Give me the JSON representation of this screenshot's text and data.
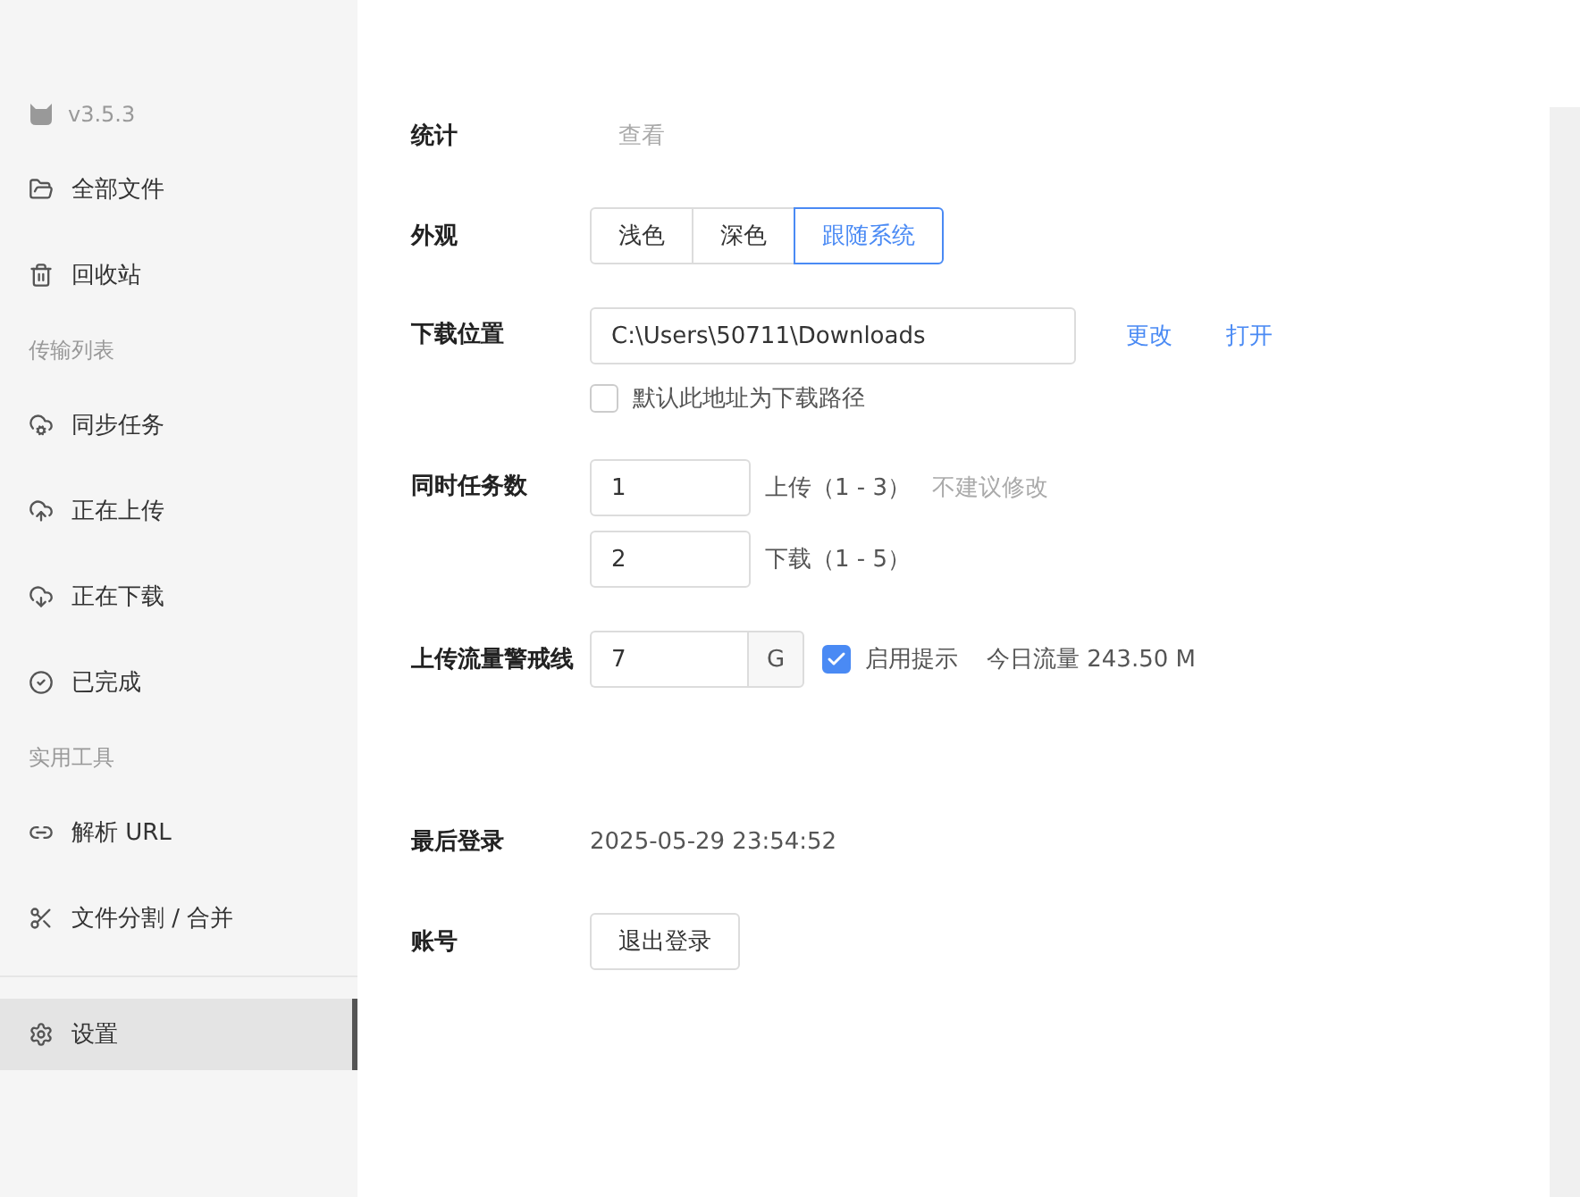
{
  "app": {
    "version": "v3.5.3"
  },
  "sidebar": {
    "items": [
      {
        "kind": "item",
        "label": "全部文件",
        "selected": false
      },
      {
        "kind": "item",
        "label": "回收站",
        "selected": false
      },
      {
        "kind": "section",
        "label": "传输列表"
      },
      {
        "kind": "item",
        "label": "同步任务",
        "selected": false
      },
      {
        "kind": "item",
        "label": "正在上传",
        "selected": false
      },
      {
        "kind": "item",
        "label": "正在下载",
        "selected": false
      },
      {
        "kind": "item",
        "label": "已完成",
        "selected": false
      },
      {
        "kind": "section",
        "label": "实用工具"
      },
      {
        "kind": "item",
        "label": "解析 URL",
        "selected": false
      },
      {
        "kind": "item",
        "label": "文件分割 / 合并",
        "selected": false
      },
      {
        "kind": "divider"
      },
      {
        "kind": "item",
        "label": "设置",
        "selected": true
      }
    ]
  },
  "settings": {
    "stats": {
      "label": "统计",
      "link": "查看"
    },
    "appearance": {
      "label": "外观",
      "options": [
        {
          "label": "浅色",
          "selected": false
        },
        {
          "label": "深色",
          "selected": false
        },
        {
          "label": "跟随系统",
          "selected": true
        }
      ]
    },
    "download_location": {
      "label": "下载位置",
      "value": "C:\\Users\\50711\\Downloads",
      "change": "更改",
      "open": "打开",
      "default_checkbox": {
        "label": "默认此地址为下载路径",
        "checked": false
      }
    },
    "concurrent_tasks": {
      "label": "同时任务数",
      "upload": {
        "value": "1",
        "label": "上传（1 - 3）",
        "hint": "不建议修改"
      },
      "download": {
        "value": "2",
        "label": "下载（1 - 5）"
      }
    },
    "upload_limit": {
      "label": "上传流量警戒线",
      "value": "7",
      "unit": "G",
      "notify": {
        "label": "启用提示",
        "checked": true
      },
      "today": "今日流量 243.50 M"
    },
    "last_login": {
      "label": "最后登录",
      "value": "2025-05-29 23:54:52"
    },
    "account": {
      "label": "账号",
      "logout": "退出登录"
    }
  }
}
